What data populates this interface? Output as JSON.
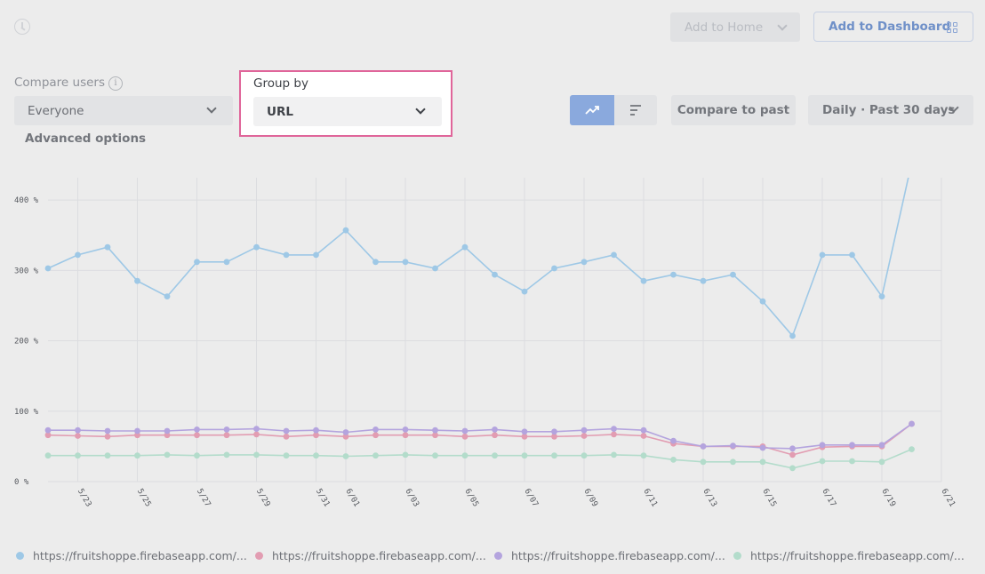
{
  "toolbar": {
    "add_to_home": "Add to Home",
    "add_to_dashboard": "Add to Dashboard"
  },
  "filters": {
    "compare_users_label": "Compare users",
    "compare_users_value": "Everyone",
    "advanced_options": "Advanced options",
    "group_by_label": "Group by",
    "group_by_value": "URL",
    "compare_to_past": "Compare to past",
    "time_range": "Daily · Past 30 days"
  },
  "icons": {
    "history": "clock-icon",
    "info": "info-icon",
    "line_mode": "trend-up-icon",
    "bar_mode": "sort-bars-icon",
    "dashboard": "grid-icon"
  },
  "colors": {
    "accent": "#8aa9dd",
    "highlight_border": "#e0659a",
    "series": [
      "#9ec8e6",
      "#e29db2",
      "#b4a4de",
      "#b3dccb"
    ]
  },
  "legend": [
    "https://fruitshoppe.firebaseapp.com/...",
    "https://fruitshoppe.firebaseapp.com/...",
    "https://fruitshoppe.firebaseapp.com/...",
    "https://fruitshoppe.firebaseapp.com/..."
  ],
  "chart_data": {
    "type": "line",
    "x": [
      "5/22",
      "5/23",
      "5/24",
      "5/25",
      "5/26",
      "5/27",
      "5/28",
      "5/29",
      "5/30",
      "5/31",
      "6/01",
      "6/02",
      "6/03",
      "6/04",
      "6/05",
      "6/06",
      "6/07",
      "6/08",
      "6/09",
      "6/10",
      "6/11",
      "6/12",
      "6/13",
      "6/14",
      "6/15",
      "6/16",
      "6/17",
      "6/18",
      "6/19",
      "6/20",
      "6/21"
    ],
    "x_tick_labels": [
      "5/23",
      "5/25",
      "5/27",
      "5/29",
      "5/31",
      "6/01",
      "6/03",
      "6/05",
      "6/07",
      "6/09",
      "6/11",
      "6/13",
      "6/15",
      "6/17",
      "6/19",
      "6/21"
    ],
    "y_tick_labels": [
      "0 %",
      "100 %",
      "200 %",
      "300 %",
      "400 %"
    ],
    "ylim": [
      0,
      450
    ],
    "grid": true,
    "legend_position": "bottom",
    "series": [
      {
        "color": "#9ec8e6",
        "values": [
          303,
          322,
          333,
          285,
          263,
          312,
          312,
          333,
          322,
          322,
          357,
          312,
          312,
          303,
          333,
          294,
          270,
          303,
          312,
          322,
          285,
          294,
          285,
          294,
          256,
          207,
          322,
          322,
          263,
          453
        ]
      },
      {
        "color": "#e29db2",
        "values": [
          66,
          65,
          64,
          66,
          66,
          66,
          66,
          67,
          64,
          66,
          64,
          66,
          66,
          66,
          64,
          66,
          64,
          64,
          65,
          67,
          65,
          54,
          50,
          50,
          50,
          38,
          49,
          50,
          50,
          82
        ]
      },
      {
        "color": "#b4a4de",
        "values": [
          73,
          73,
          72,
          72,
          72,
          74,
          74,
          75,
          72,
          73,
          70,
          74,
          74,
          73,
          72,
          74,
          71,
          71,
          73,
          75,
          73,
          58,
          50,
          51,
          48,
          47,
          52,
          52,
          52,
          82
        ]
      },
      {
        "color": "#b3dccb",
        "values": [
          37,
          37,
          37,
          37,
          38,
          37,
          38,
          38,
          37,
          37,
          36,
          37,
          38,
          37,
          37,
          37,
          37,
          37,
          37,
          38,
          37,
          31,
          28,
          28,
          28,
          19,
          29,
          29,
          28,
          46
        ]
      }
    ]
  }
}
